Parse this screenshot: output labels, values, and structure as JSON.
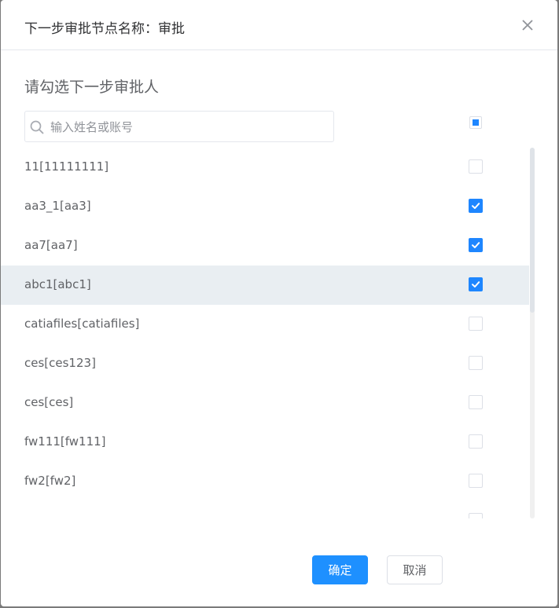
{
  "dialog": {
    "title": "下一步审批节点名称：审批",
    "section_title": "请勾选下一步审批人",
    "search": {
      "placeholder": "输入姓名或账号",
      "value": ""
    },
    "select_all_state": "indeterminate",
    "accent_color": "#1e86ff",
    "items": [
      {
        "label": "11[11111111]",
        "checked": false
      },
      {
        "label": "aa3_1[aa3]",
        "checked": true
      },
      {
        "label": "aa7[aa7]",
        "checked": true
      },
      {
        "label": "abc1[abc1]",
        "checked": true,
        "hovered": true
      },
      {
        "label": "catiafiles[catiafiles]",
        "checked": false
      },
      {
        "label": "ces[ces123]",
        "checked": false
      },
      {
        "label": "ces[ces]",
        "checked": false
      },
      {
        "label": "fw111[fw111]",
        "checked": false
      },
      {
        "label": "fw2[fw2]",
        "checked": false
      },
      {
        "label": "",
        "checked": false
      }
    ],
    "buttons": {
      "confirm": "确定",
      "cancel": "取消"
    }
  }
}
